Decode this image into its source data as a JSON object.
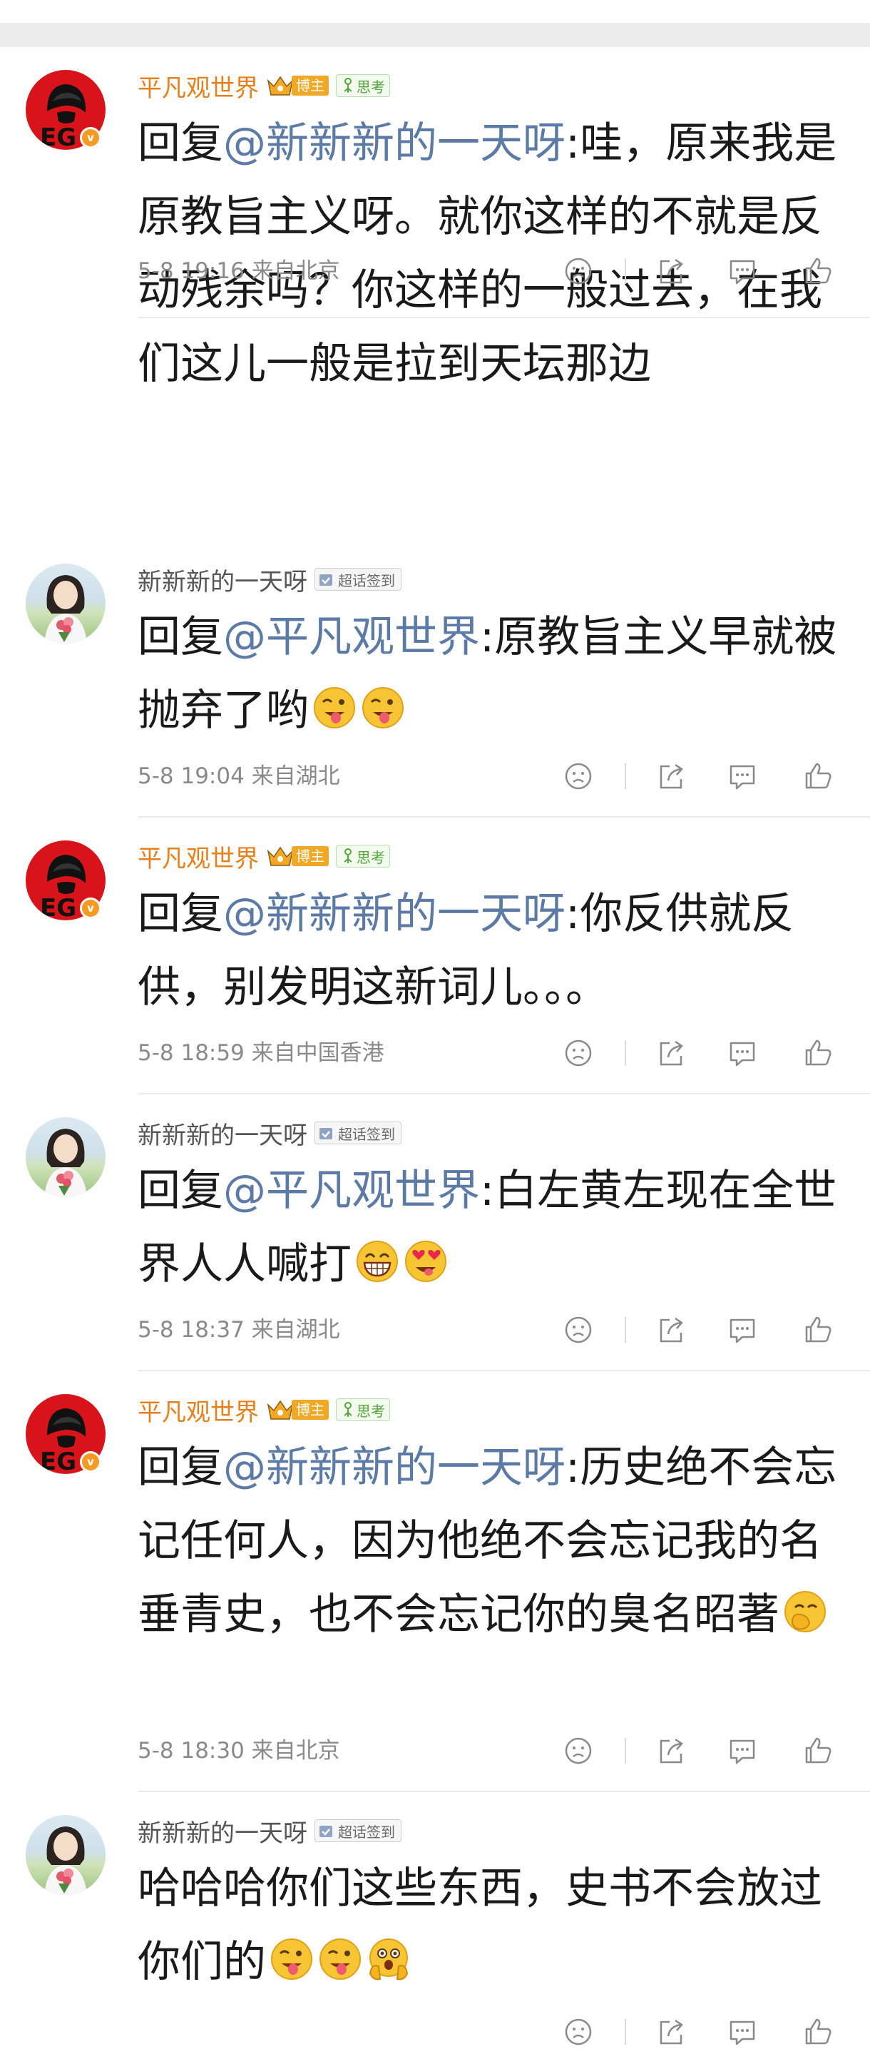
{
  "comments": [
    {
      "user": "平凡观世界",
      "badge_blogger": "博主",
      "badge_think": "思考",
      "reply_prefix": "回复",
      "mention": "@新新新的一天呀",
      "text": ":哇，原来我是原教旨主义呀。就你这样的不就是反动残余吗？你这样的一般过去，在我们这儿一般是拉到天坛那边",
      "meta": "5-8 19:16 来自北京"
    },
    {
      "user": "新新新的一天呀",
      "badge_topic": "超话签到",
      "reply_prefix": "回复",
      "mention": "@平凡观世界",
      "text": ":原教旨主义早就被抛弃了哟",
      "emojis": [
        "tongue-wink-emoji",
        "tongue-wink-emoji"
      ],
      "meta": "5-8 19:04 来自湖北"
    },
    {
      "user": "平凡观世界",
      "badge_blogger": "博主",
      "badge_think": "思考",
      "reply_prefix": "回复",
      "mention": "@新新新的一天呀",
      "text": ":你反供就反供，别发明这新词儿。。。",
      "meta": "5-8 18:59 来自中国香港"
    },
    {
      "user": "新新新的一天呀",
      "badge_topic": "超话签到",
      "reply_prefix": "回复",
      "mention": "@平凡观世界",
      "text": ":白左黄左现在全世界人人喊打",
      "emojis": [
        "grin-teeth-emoji",
        "heart-eyes-emoji"
      ],
      "meta": "5-8 18:37 来自湖北"
    },
    {
      "user": "平凡观世界",
      "badge_blogger": "博主",
      "badge_think": "思考",
      "reply_prefix": "回复",
      "mention": "@新新新的一天呀",
      "text": ":历史绝不会忘记任何人，因为他绝不会忘记我的名垂青史，也不会忘记你的臭名昭著",
      "emojis": [
        "hand-over-mouth-emoji"
      ],
      "meta": "5-8 18:30 来自北京"
    },
    {
      "user": "新新新的一天呀",
      "badge_topic": "超话签到",
      "reply_prefix": "",
      "mention": "",
      "text": "哈哈哈你们这些东西，史书不会放过你们的",
      "emojis": [
        "tongue-wink-emoji",
        "tongue-wink-emoji",
        "shocked-hands-emoji"
      ],
      "meta": ""
    }
  ],
  "icons": {
    "dislike": "frown-face-icon",
    "repost": "repost-icon",
    "comment": "comment-bubble-icon",
    "like": "thumbs-up-icon"
  },
  "colors": {
    "mention": "#5b7aa6",
    "username_blogger": "#e8801b",
    "username_user": "#555555",
    "meta": "#8a8a8a",
    "badge_blogger": "#f0a825",
    "badge_think": "#55a63a",
    "verified": "#f59a23"
  }
}
